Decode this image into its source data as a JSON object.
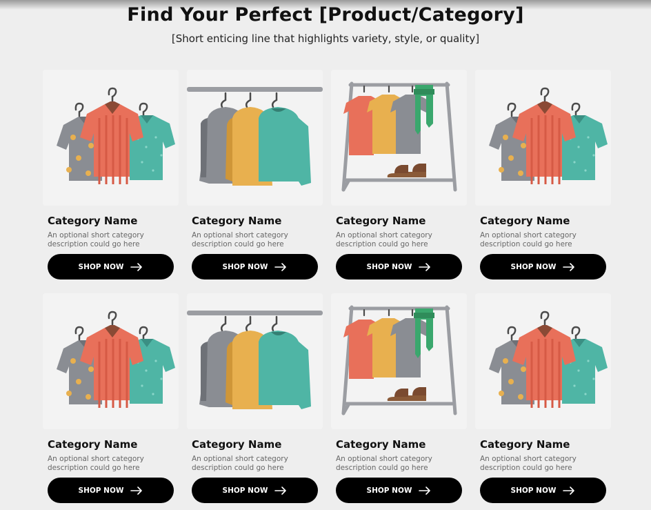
{
  "header": {
    "title": "Find Your Perfect [Product/Category]",
    "subtitle": "[Short enticing line that highlights variety, style, or quality]"
  },
  "cards": [
    {
      "name": "Category Name",
      "desc": "An optional short category description could go here",
      "button": "SHOP NOW",
      "image": "shirts-on-hangers",
      "icon": "arrow-right-icon"
    },
    {
      "name": "Category Name",
      "desc": "An optional short category description could go here",
      "button": "SHOP NOW",
      "image": "sweaters-on-rail",
      "icon": "arrow-right-icon"
    },
    {
      "name": "Category Name",
      "desc": "An optional short category description could go here",
      "button": "SHOP NOW",
      "image": "clothing-rack",
      "icon": "arrow-right-icon"
    },
    {
      "name": "Category Name",
      "desc": "An optional short category description could go here",
      "button": "SHOP NOW",
      "image": "shirts-on-hangers",
      "icon": "arrow-right-icon"
    },
    {
      "name": "Category Name",
      "desc": "An optional short category description could go here",
      "button": "SHOP NOW",
      "image": "shirts-on-hangers",
      "icon": "arrow-right-icon"
    },
    {
      "name": "Category Name",
      "desc": "An optional short category description could go here",
      "button": "SHOP NOW",
      "image": "sweaters-on-rail",
      "icon": "arrow-right-icon"
    },
    {
      "name": "Category Name",
      "desc": "An optional short category description could go here",
      "button": "SHOP NOW",
      "image": "clothing-rack",
      "icon": "arrow-right-icon"
    },
    {
      "name": "Category Name",
      "desc": "An optional short category description could go here",
      "button": "SHOP NOW",
      "image": "shirts-on-hangers",
      "icon": "arrow-right-icon"
    }
  ],
  "colors": {
    "background": "#eeeeee",
    "card_image_bg": "#f3f3f3",
    "button_bg": "#000000",
    "button_text": "#ffffff",
    "shirt_red": "#e8705a",
    "shirt_gray": "#8a8d93",
    "shirt_teal": "#4fb5a5",
    "shirt_yellow": "#e8b04f",
    "scarf_green": "#3aa76d"
  }
}
